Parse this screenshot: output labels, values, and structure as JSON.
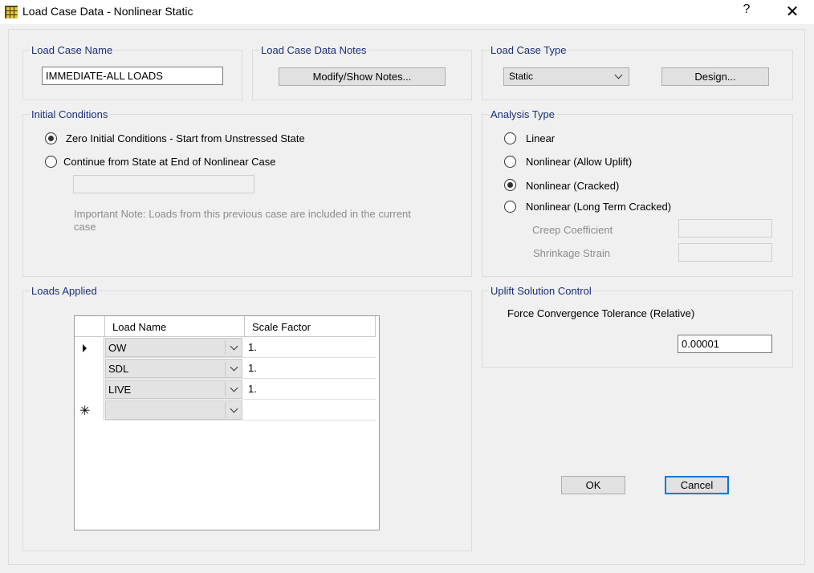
{
  "window": {
    "title": "Load Case Data - Nonlinear Static",
    "help": "?",
    "close": "✕"
  },
  "load_case_name": {
    "legend": "Load Case Name",
    "value": "IMMEDIATE-ALL LOADS"
  },
  "notes": {
    "legend": "Load Case Data Notes",
    "button": "Modify/Show Notes..."
  },
  "load_case_type": {
    "legend": "Load Case Type",
    "selected": "Static",
    "design_button": "Design..."
  },
  "initial_conditions": {
    "legend": "Initial Conditions",
    "option_zero": "Zero Initial Conditions - Start from Unstressed State",
    "option_continue": "Continue from State at End of Nonlinear Case",
    "note": "Important Note:  Loads from this previous case are included in the current case"
  },
  "analysis_type": {
    "legend": "Analysis Type",
    "options": [
      "Linear",
      "Nonlinear (Allow Uplift)",
      "Nonlinear (Cracked)",
      "Nonlinear (Long Term Cracked)"
    ],
    "selected": "Nonlinear (Cracked)",
    "creep_label": "Creep Coefficient",
    "shrinkage_label": "Shrinkage Strain"
  },
  "loads_applied": {
    "legend": "Loads Applied",
    "columns": [
      "Load Name",
      "Scale Factor"
    ],
    "rows": [
      {
        "name": "OW",
        "factor": "1."
      },
      {
        "name": "SDL",
        "factor": "1."
      },
      {
        "name": "LIVE",
        "factor": "1."
      }
    ],
    "new_row_marker": "✳"
  },
  "uplift": {
    "legend": "Uplift Solution Control",
    "tolerance_label": "Force Convergence Tolerance (Relative)",
    "tolerance_value": "0.00001"
  },
  "buttons": {
    "ok": "OK",
    "cancel": "Cancel"
  },
  "colors": {
    "legend_text": "#1a2e7a",
    "default_button_border": "#0078d7",
    "disabled_text": "#8c8c8c"
  }
}
